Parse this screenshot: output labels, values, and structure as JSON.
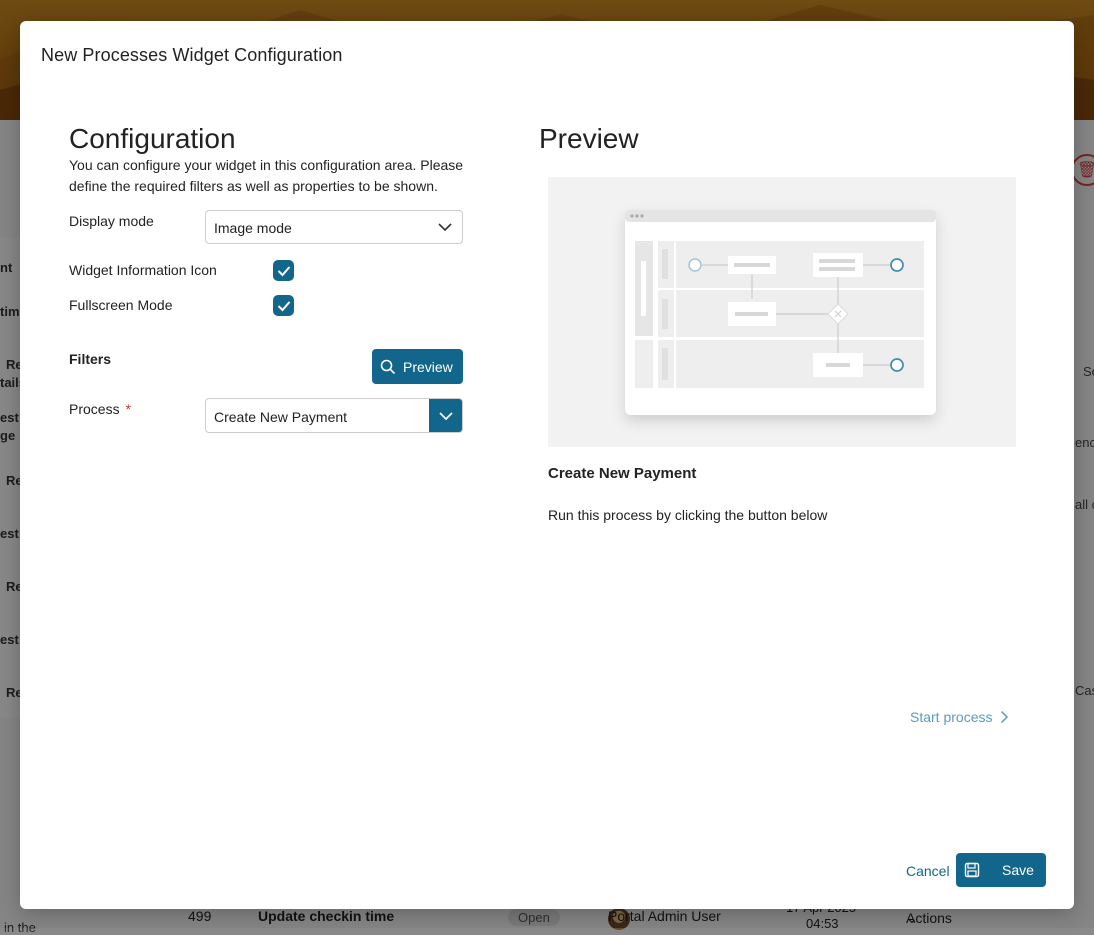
{
  "background": {
    "left_rows": [
      "nt",
      "tim",
      "Re",
      "tails",
      "est",
      "ge",
      "Re",
      "est",
      "Re",
      "est",
      "Re"
    ],
    "right_rows": [
      "Se",
      "enc",
      "all c",
      "Cas"
    ],
    "bottom_row": {
      "id": "499",
      "title": "Update checkin time",
      "status": "Open",
      "user": "Portal Admin User",
      "date": "17 Apr 2025",
      "time": "04:53",
      "actions": "Actions"
    },
    "bottom_left_text": "in the"
  },
  "modal": {
    "title": "New Processes Widget Configuration",
    "configuration": {
      "heading": "Configuration",
      "description": "You can configure your widget in this configuration area. Please define the required filters as well as properties to be shown.",
      "display_mode_label": "Display mode",
      "display_mode_value": "Image mode",
      "widget_info_icon_label": "Widget Information Icon",
      "widget_info_icon_checked": true,
      "fullscreen_label": "Fullscreen Mode",
      "fullscreen_checked": true,
      "filters_label": "Filters",
      "preview_button": "Preview",
      "process_label": "Process",
      "process_required_mark": "*",
      "process_value": "Create New Payment"
    },
    "preview": {
      "heading": "Preview",
      "process_name": "Create New Payment",
      "process_description": "Run this process by clicking the button below",
      "start_process": "Start process"
    },
    "footer": {
      "cancel": "Cancel",
      "save": "Save"
    }
  },
  "colors": {
    "primary": "#13668b",
    "link_light": "#5a9bbd",
    "required": "#c0392b"
  }
}
